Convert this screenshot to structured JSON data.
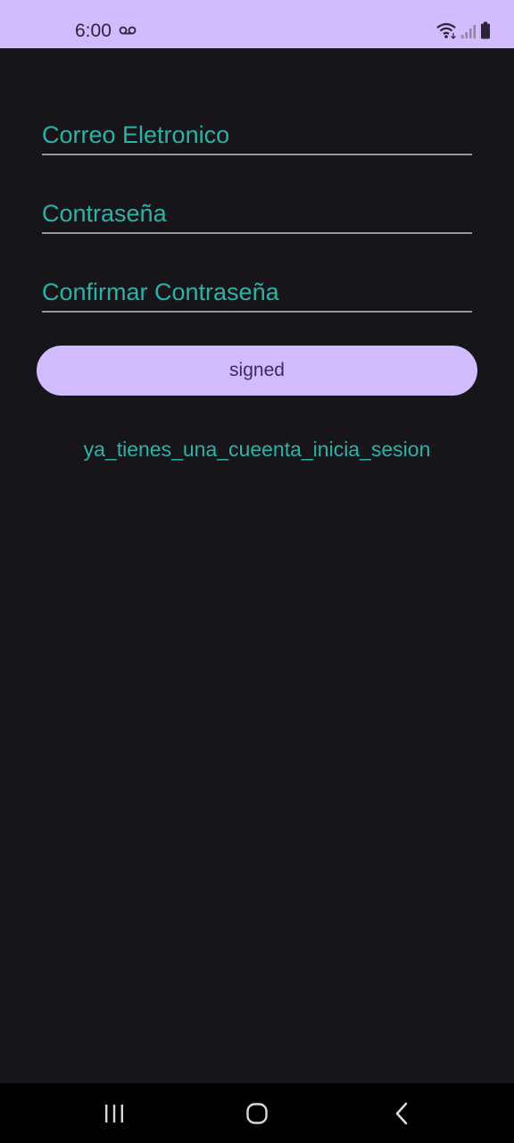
{
  "status_bar": {
    "time": "6:00",
    "icons": [
      "voicemail-icon",
      "wifi-icon",
      "signal-icon",
      "battery-icon"
    ],
    "background_color": "#d0bcff"
  },
  "form": {
    "email_label": "Correo Eletronico",
    "password_label": "Contraseña",
    "confirm_password_label": "Confirmar Contraseña"
  },
  "primary_button": {
    "label": "signed",
    "color": "#d0bcff"
  },
  "login_link": {
    "text": "ya_tienes_una_cueenta_inicia_sesion"
  },
  "navigation_bar": {
    "buttons": [
      "recents-icon",
      "home-icon",
      "back-icon"
    ]
  },
  "colors": {
    "background": "#17141a",
    "accent_text": "#2ab3a6",
    "button_text": "#3b2a66"
  }
}
